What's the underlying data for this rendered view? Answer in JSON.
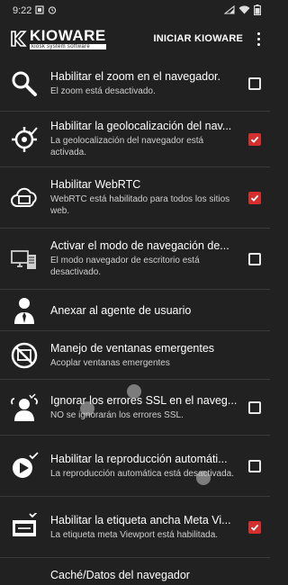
{
  "status_bar": {
    "time": "9:22",
    "left_icons": [
      "notification-icon",
      "alarm-icon"
    ],
    "right_icons": [
      "signal-icon",
      "wifi-icon",
      "battery-icon"
    ]
  },
  "app_bar": {
    "logo_title": "KIOWARE",
    "logo_subtitle": "kiosk system software",
    "action_label": "INICIAR KIOWARE",
    "menu_icon": "more-vert-icon"
  },
  "colors": {
    "background": "#212121",
    "checkbox_checked": "#d32f2f"
  },
  "settings": [
    {
      "title": "Habilitar el zoom en el navegador.",
      "subtitle": "El zoom está desactivado.",
      "checked": false,
      "icon": "zoom-icon"
    },
    {
      "title": "Habilitar la geolocalización del nav...",
      "subtitle": "La geolocalización del navegador está activada.",
      "checked": true,
      "icon": "geolocation-icon"
    },
    {
      "title": "Habilitar WebRTC",
      "subtitle": "WebRTC está habilitado para todos los sitios web.",
      "checked": true,
      "icon": "webrtc-icon"
    },
    {
      "title": "Activar el modo de navegación de...",
      "subtitle": "El modo navegador de escritorio está desactivado.",
      "checked": false,
      "icon": "desktop-mode-icon"
    },
    {
      "title": "Anexar al agente de usuario",
      "subtitle": "",
      "checked": null,
      "icon": "user-agent-icon"
    },
    {
      "title": "Manejo de ventanas emergentes",
      "subtitle": "Acoplar ventanas emergentes",
      "checked": null,
      "icon": "popup-block-icon"
    },
    {
      "title": "Ignorar los errores SSL en el naveg...",
      "subtitle": "NO se ignorarán los errores SSL.",
      "checked": false,
      "icon": "ssl-errors-icon"
    },
    {
      "title": "Habilitar la reproducción automáti...",
      "subtitle": "La reproducción automática está desactivada.",
      "checked": false,
      "icon": "autoplay-icon"
    },
    {
      "title": "Habilitar la etiqueta ancha Meta Vi...",
      "subtitle": "La etiqueta meta Viewport está habilitada.",
      "checked": true,
      "icon": "meta-viewport-icon"
    },
    {
      "title": "Caché/Datos del navegador",
      "subtitle": "",
      "checked": null,
      "icon": "cache-icon"
    }
  ]
}
